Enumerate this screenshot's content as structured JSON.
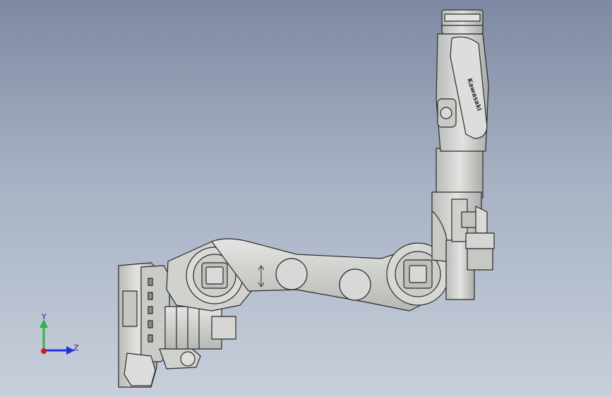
{
  "viewport": {
    "background_top": "#7e8aa3",
    "background_bottom": "#c8cfdb",
    "model_color": "#d2d4d0",
    "edge_color": "#2a2a2a"
  },
  "model": {
    "brand_text": "Kawasaki"
  },
  "triad": {
    "y_label": "Y",
    "z_label": "Z",
    "y_color": "#2fb34a",
    "z_color": "#1d34d8",
    "origin_color": "#d01c1c"
  }
}
